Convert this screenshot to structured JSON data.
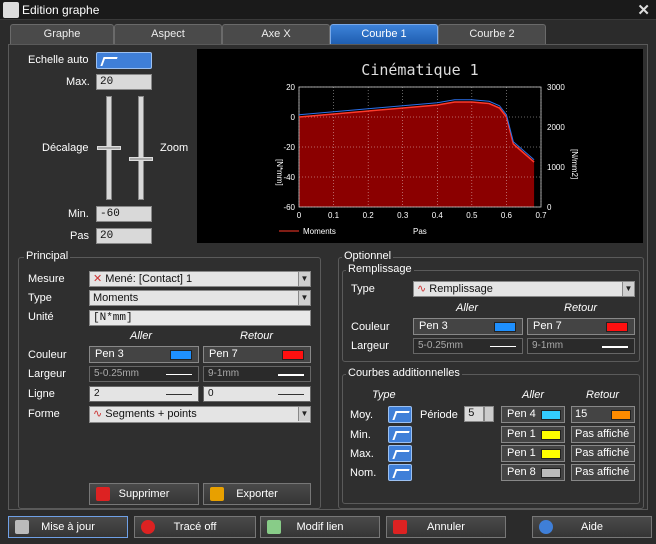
{
  "window": {
    "title": "Edition graphe",
    "close": "✕"
  },
  "tabs": [
    "Graphe",
    "Aspect",
    "Axe X",
    "Courbe 1",
    "Courbe 2"
  ],
  "scale": {
    "auto_label": "Echelle auto",
    "max_label": "Max.",
    "max_value": "20",
    "offset_label": "Décalage",
    "zoom_label": "Zoom",
    "min_label": "Min.",
    "min_value": "-60",
    "step_label": "Pas",
    "step_value": "20"
  },
  "chart_data": {
    "type": "line",
    "title": "Cinématique 1",
    "xlabel": "Pas",
    "ylabel": "[N*mm]",
    "y2label": "[N/mm2]",
    "x_ticks": [
      "0",
      "0.1",
      "0.2",
      "0.3",
      "0.4",
      "0.5",
      "0.6",
      "0.7"
    ],
    "y_ticks": [
      "20",
      "0",
      "-20",
      "-40",
      "-60"
    ],
    "y2_ticks": [
      "3000",
      "2000",
      "1000",
      "0"
    ],
    "legend": "Moments",
    "xlim": [
      0,
      0.7
    ],
    "ylim": [
      -60,
      20
    ],
    "series": [
      {
        "values_x": [
          0,
          0.1,
          0.2,
          0.3,
          0.35,
          0.4,
          0.45,
          0.5,
          0.55,
          0.58,
          0.6,
          0.62,
          0.64,
          0.66,
          0.68
        ],
        "values_y": [
          0,
          2,
          4,
          6,
          7,
          8,
          10,
          10,
          9,
          6,
          0,
          -18,
          -22,
          -26,
          -30
        ]
      }
    ],
    "colors": {
      "fill": "#8b0000",
      "line": "#ff3a2a",
      "line2": "#2a6fe8",
      "bg": "#000000",
      "grid": "#ffffff"
    }
  },
  "principal": {
    "title": "Principal",
    "mesure_label": "Mesure",
    "mesure_value": "Mené: [Contact] 1",
    "type_label": "Type",
    "type_value": "Moments",
    "unite_label": "Unité",
    "unite_value": "[N*mm]",
    "aller": "Aller",
    "retour": "Retour",
    "couleur_label": "Couleur",
    "pen_aller": "Pen 3",
    "pen_retour": "Pen 7",
    "largeur_label": "Largeur",
    "larg_aller": "5-0.25mm",
    "larg_retour": "9-1mm",
    "ligne_label": "Ligne",
    "ligne_aller": "2",
    "ligne_retour": "0",
    "forme_label": "Forme",
    "forme_value": "Segments + points",
    "supprimer": "Supprimer",
    "exporter": "Exporter"
  },
  "optionnel": {
    "title": "Optionnel",
    "remplissage": "Remplissage",
    "type_label": "Type",
    "type_value": "Remplissage",
    "aller": "Aller",
    "retour": "Retour",
    "couleur_label": "Couleur",
    "pen_aller": "Pen 3",
    "pen_retour": "Pen 7",
    "largeur_label": "Largeur",
    "larg_aller": "5-0.25mm",
    "larg_retour": "9-1mm",
    "courbes": "Courbes additionnelles",
    "type_hdr": "Type",
    "rows": [
      {
        "label": "Moy.",
        "aller": "Pen 4",
        "aller_color": "#33ccff",
        "retour": "15",
        "retour_color": "#ff8c00"
      },
      {
        "label": "Min.",
        "aller": "Pen 1",
        "aller_color": "#ffff00",
        "retour": "Pas affiché",
        "retour_color": ""
      },
      {
        "label": "Max.",
        "aller": "Pen 1",
        "aller_color": "#ffff00",
        "retour": "Pas affiché",
        "retour_color": ""
      },
      {
        "label": "Nom.",
        "aller": "Pen 8",
        "aller_color": "#bbbbbb",
        "retour": "Pas affiché",
        "retour_color": ""
      }
    ],
    "periode_label": "Période",
    "periode_value": "5"
  },
  "footer": {
    "maj": "Mise à jour",
    "trace": "Tracé off",
    "modif": "Modif lien",
    "annuler": "Annuler",
    "aide": "Aide"
  }
}
